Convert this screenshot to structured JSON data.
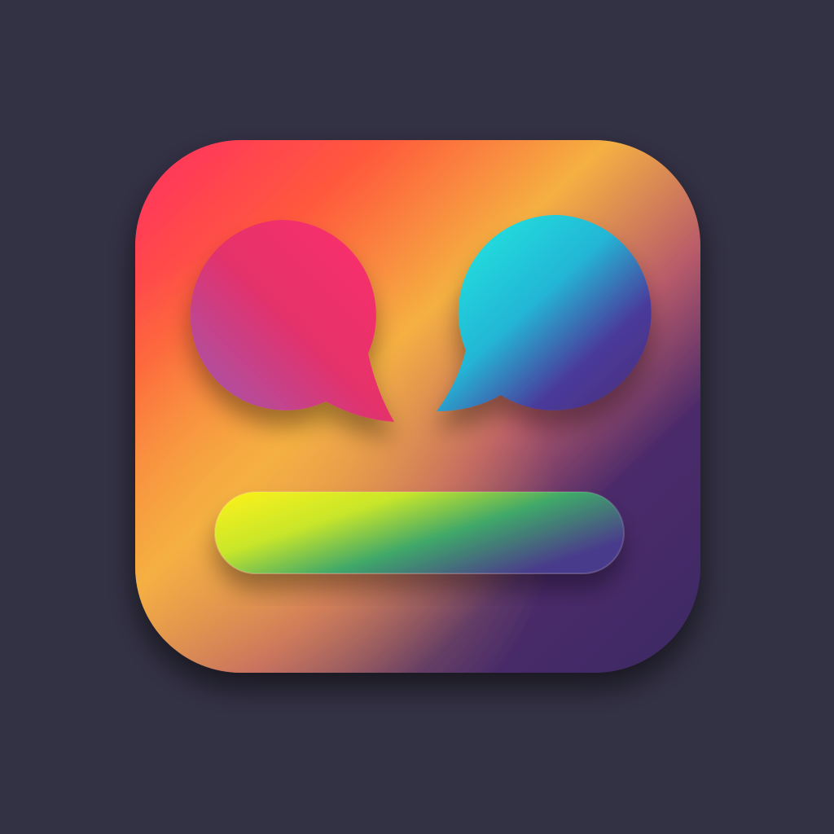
{
  "app_icon": {
    "name": "chat-app-icon",
    "colors": {
      "page_background": "#333144",
      "tile_gradient": [
        "#ff2e63",
        "#ff5a3c",
        "#f5b042",
        "#b85b6a",
        "#4b2a6b",
        "#3d2a63"
      ],
      "left_bubble_gradient": [
        "#ff2f6e",
        "#e5306a",
        "#9b5bb5"
      ],
      "right_bubble_gradient": [
        "#1ff0e0",
        "#24b6d6",
        "#4a3a9a",
        "#4b2f78"
      ],
      "bar_gradient": [
        "#fff21a",
        "#c8e62a",
        "#3fa76a",
        "#4a3b8c"
      ]
    }
  }
}
